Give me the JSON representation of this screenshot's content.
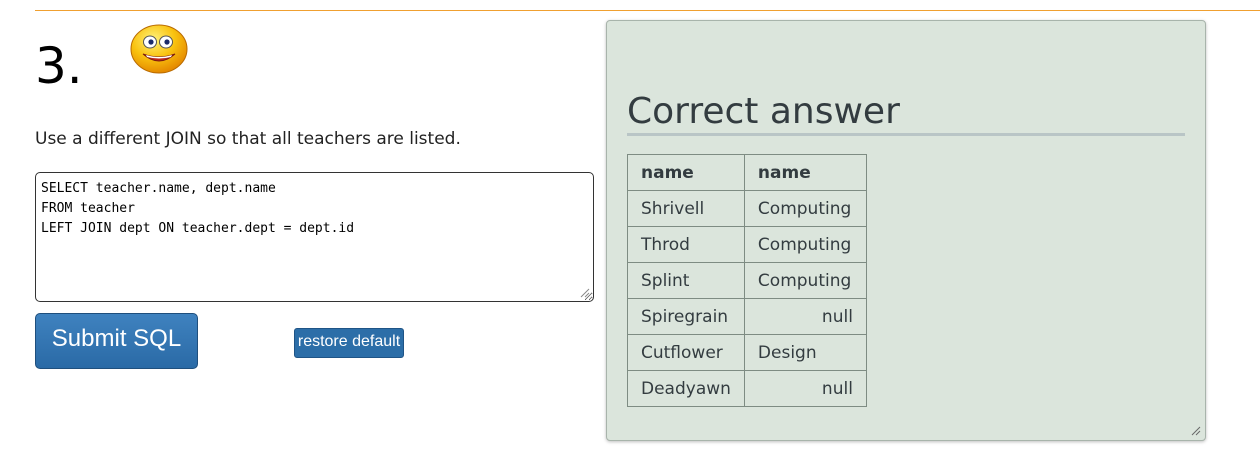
{
  "question": {
    "number": "3.",
    "prompt": "Use a different JOIN so that all teachers are listed."
  },
  "editor": {
    "sql": "SELECT teacher.name, dept.name\nFROM teacher\nLEFT JOIN dept ON teacher.dept = dept.id"
  },
  "buttons": {
    "submit": "Submit SQL",
    "restore": "restore default"
  },
  "answer": {
    "title": "Correct answer",
    "columns": [
      "name",
      "name"
    ],
    "rows": [
      [
        "Shrivell",
        "Computing"
      ],
      [
        "Throd",
        "Computing"
      ],
      [
        "Splint",
        "Computing"
      ],
      [
        "Spiregrain",
        "null"
      ],
      [
        "Cutflower",
        "Design"
      ],
      [
        "Deadyawn",
        "null"
      ]
    ]
  },
  "colors": {
    "accent_rule": "#f0a030",
    "button_blue": "#2c6ea8",
    "panel_bg": "#dbe5dc"
  },
  "icons": {
    "status": "smiley-face-icon"
  }
}
